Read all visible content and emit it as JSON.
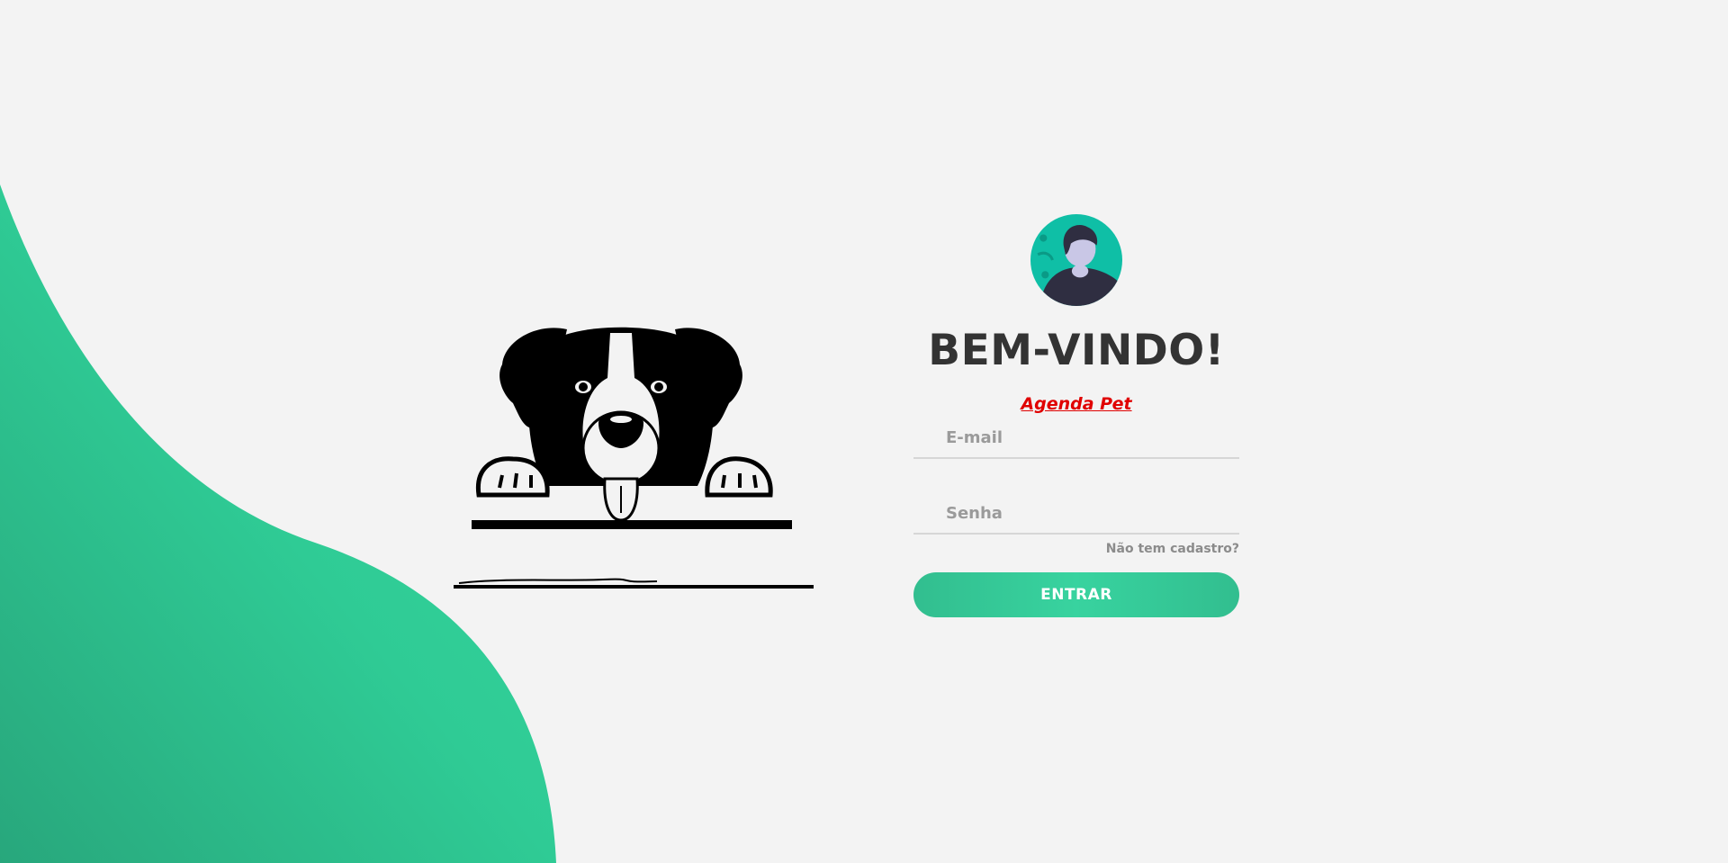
{
  "login": {
    "title": "BEM-VINDO!",
    "brand_link": "Agenda Pet",
    "email_placeholder": "E-mail",
    "password_placeholder": "Senha",
    "signup_link": "Não tem cadastro?",
    "submit_label": "ENTRAR"
  },
  "theme": {
    "accent": "#38d39f",
    "accent_dark": "#32be8f",
    "avatar_bg": "#0fbfa6",
    "brand_color": "#e00000",
    "title_color": "#333333",
    "background": "#f3f3f3"
  },
  "icons": {
    "avatar": "user-avatar-icon",
    "illustration": "peeking-dog-illustration"
  }
}
